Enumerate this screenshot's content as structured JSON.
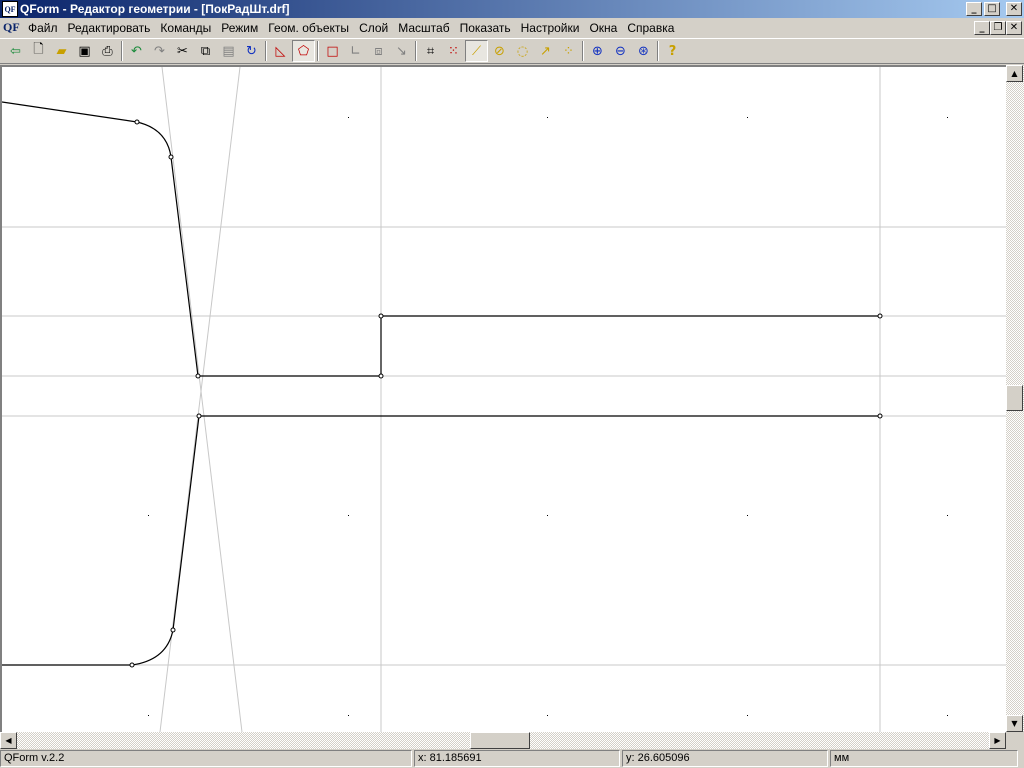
{
  "window": {
    "app_icon": "QF",
    "title": "QForm - Редактор геометрии  - [ПокРадШт.drf]",
    "controls": [
      "minimize-icon",
      "maximize-icon",
      "close-icon"
    ]
  },
  "menu": {
    "doc_icon": "QF",
    "items": [
      "Файл",
      "Редактировать",
      "Команды",
      "Режим",
      "Геом. объекты",
      "Слой",
      "Масштаб",
      "Показать",
      "Настройки",
      "Окна",
      "Справка"
    ]
  },
  "toolbar": {
    "icons": [
      "exit-icon",
      "new-file-icon",
      "open-folder-icon",
      "save-icon",
      "print-icon",
      "undo-icon",
      "redo-icon",
      "cut-icon",
      "copy-icon",
      "paste-icon",
      "refresh-icon",
      "polygon-icon",
      "polygon-select-icon",
      "rectangle-icon",
      "corner-icon",
      "move-icon",
      "arrow-icon",
      "trim-icon",
      "points-icon",
      "line-tool-icon",
      "circle-tool-icon",
      "arc-tool-icon",
      "curve-tool-icon",
      "node-tool-icon",
      "zoom-in-icon",
      "zoom-out-icon",
      "zoom-fit-icon",
      "help-icon"
    ],
    "help_label": "?"
  },
  "status": {
    "version": "QForm v.2.2",
    "x": "x: 81.185691",
    "y": "y: 26.605096",
    "units": "мм"
  }
}
